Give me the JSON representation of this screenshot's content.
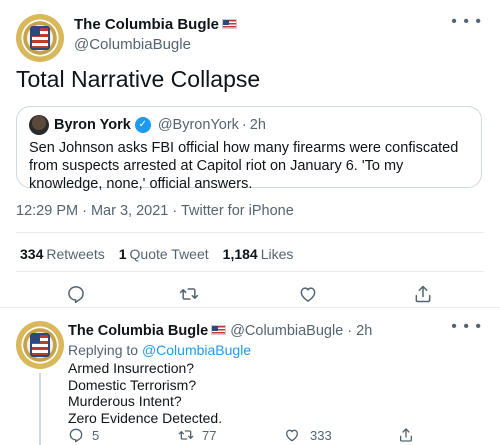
{
  "tweet": {
    "display_name": "The Columbia Bugle",
    "handle": "@ColumbiaBugle",
    "text": "Total Narrative Collapse",
    "quote": {
      "display_name": "Byron York",
      "handle": "@ByronYork",
      "dot": "·",
      "time": "2h",
      "text": "Sen Johnson asks FBI official how many firearms were confiscated from suspects arrested at Capitol riot on January 6. 'To my knowledge, none,' official answers."
    },
    "meta": "12:29 PM · Mar 3, 2021 · Twitter for iPhone",
    "stats": {
      "retweets_count": "334",
      "retweets_label": "Retweets",
      "quote_count": "1",
      "quote_label": "Quote Tweet",
      "likes_count": "1,184",
      "likes_label": "Likes"
    }
  },
  "reply": {
    "display_name": "The Columbia Bugle",
    "handle": "@ColumbiaBugle",
    "dot": "·",
    "time": "2h",
    "replying_prefix": "Replying to",
    "replying_to": "@ColumbiaBugle",
    "lines": [
      "Armed Insurrection?",
      "Domestic Terrorism?",
      "Murderous Intent?",
      "Zero Evidence Detected."
    ],
    "counts": {
      "replies": "5",
      "retweets": "77",
      "likes": "333"
    }
  },
  "icons": {
    "more": "more-icon",
    "reply": "reply-icon",
    "retweet": "retweet-icon",
    "like": "heart-icon",
    "share": "share-icon",
    "verified": "verified-icon",
    "flag": "us-flag-icon"
  },
  "colors": {
    "accent": "#1d9bf0",
    "muted": "#536471",
    "text": "#0f1419",
    "border": "#cfd9de"
  }
}
